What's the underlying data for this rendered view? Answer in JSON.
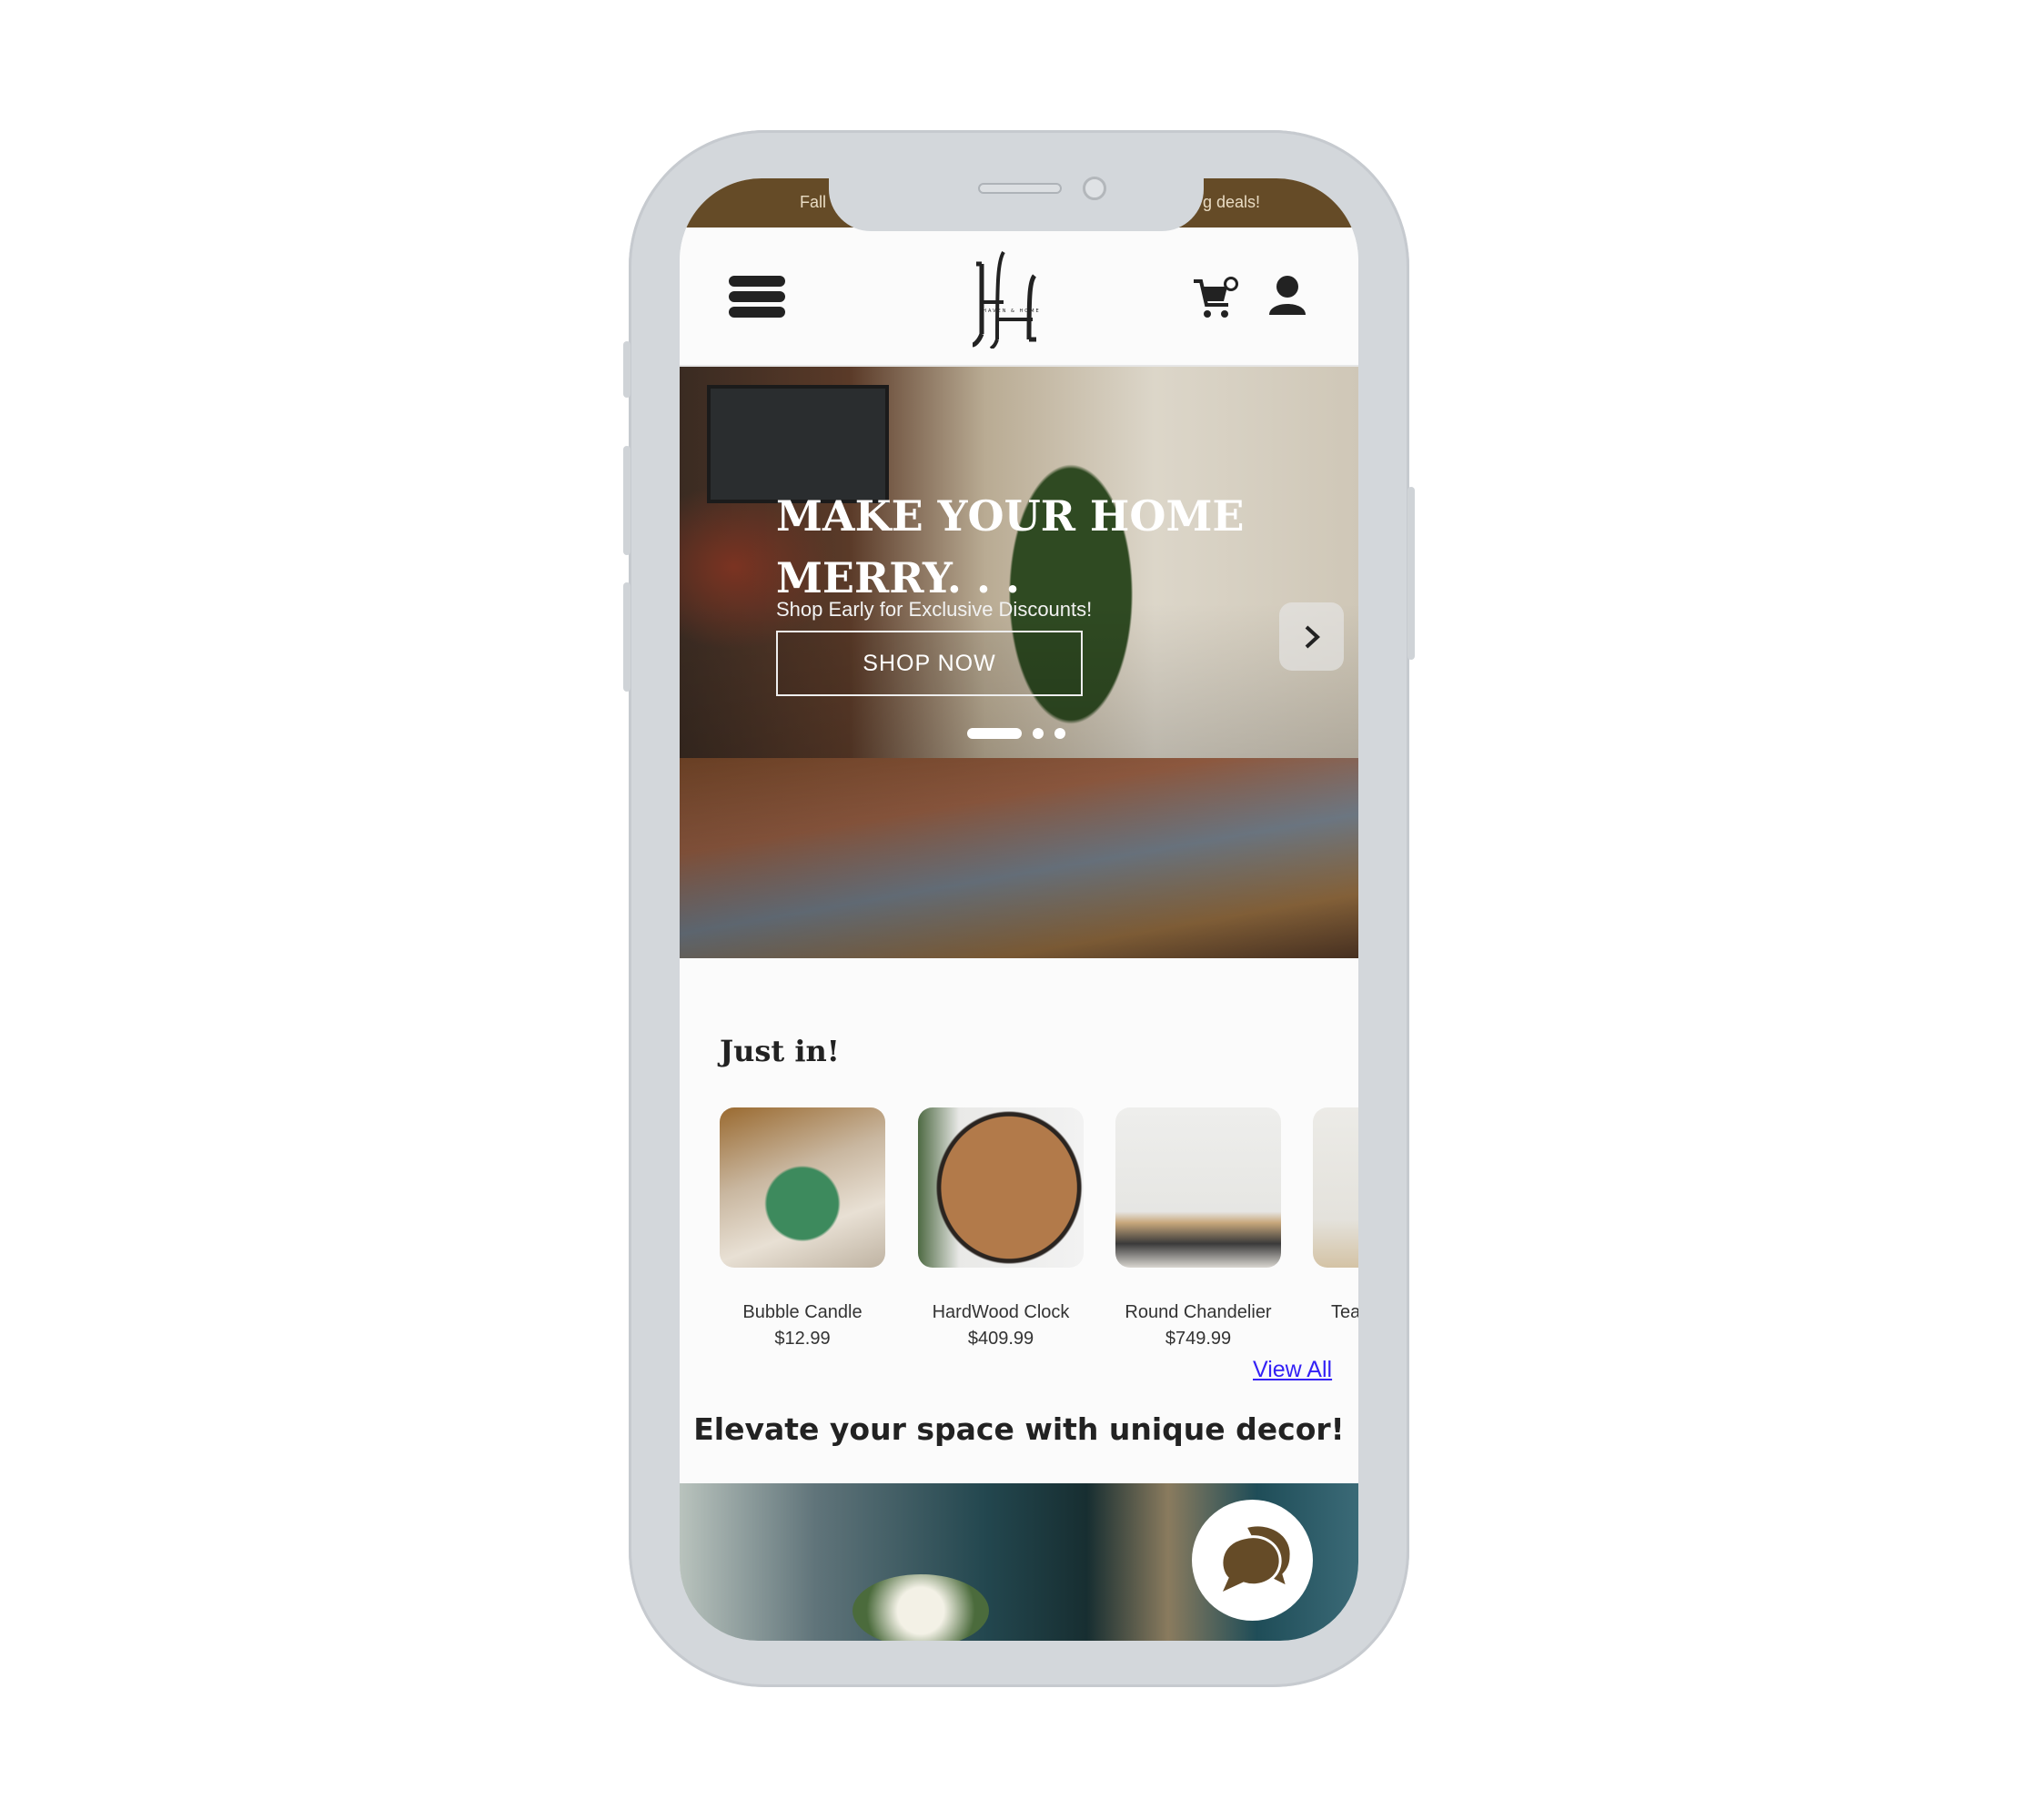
{
  "banner": {
    "text_left": "Fall",
    "text_right": "g deals!",
    "color": "#654b27"
  },
  "header": {
    "menu_icon": "hamburger-icon",
    "logo_text": "HAVEN & HOME",
    "cart_count": "0",
    "cart_icon": "cart-icon",
    "user_icon": "user-icon"
  },
  "hero": {
    "title": "MAKE YOUR HOME MERRY. . .",
    "subtitle": "Shop Early for Exclusive Discounts!",
    "button": "SHOP NOW",
    "slides": 3,
    "active_slide": 1
  },
  "just_in": {
    "title": "Just in!",
    "products": [
      {
        "name": "Bubble Candle",
        "price": "$12.99"
      },
      {
        "name": "HardWood Clock",
        "price": "$409.99"
      },
      {
        "name": "Round Chandelier",
        "price": "$749.99"
      },
      {
        "name": "Tea",
        "price": ""
      }
    ],
    "view_all": "View All"
  },
  "tagline": "Elevate your space with unique decor!",
  "chat": {
    "icon": "chat-bubble-icon",
    "color": "#654b27"
  }
}
